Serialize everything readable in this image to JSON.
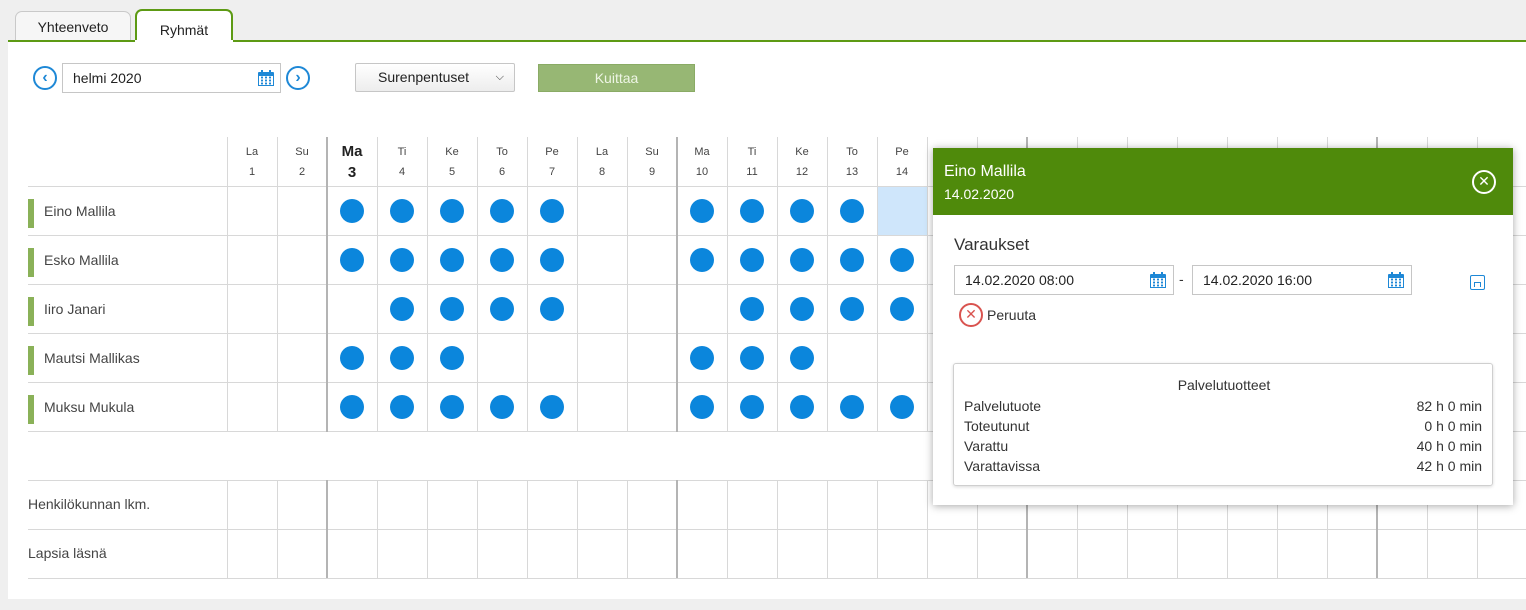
{
  "tabs": [
    {
      "label": "Yhteenveto",
      "active": false
    },
    {
      "label": "Ryhmät",
      "active": true
    }
  ],
  "toolbar": {
    "month": "helmi 2020",
    "group": "Surenpentuset",
    "acknowledge_label": "Kuittaa"
  },
  "calendar": {
    "days": [
      {
        "name": "La",
        "num": "1"
      },
      {
        "name": "Su",
        "num": "2"
      },
      {
        "name": "Ma",
        "num": "3",
        "today": true
      },
      {
        "name": "Ti",
        "num": "4"
      },
      {
        "name": "Ke",
        "num": "5"
      },
      {
        "name": "To",
        "num": "6"
      },
      {
        "name": "Pe",
        "num": "7"
      },
      {
        "name": "La",
        "num": "8"
      },
      {
        "name": "Su",
        "num": "9"
      },
      {
        "name": "Ma",
        "num": "10"
      },
      {
        "name": "Ti",
        "num": "11"
      },
      {
        "name": "Ke",
        "num": "12"
      },
      {
        "name": "To",
        "num": "13"
      },
      {
        "name": "Pe",
        "num": "14"
      }
    ],
    "children": [
      {
        "name": "Eino Mallila",
        "booked_days": [
          3,
          4,
          5,
          6,
          7,
          10,
          11,
          12,
          13
        ]
      },
      {
        "name": "Esko Mallila",
        "booked_days": [
          3,
          4,
          5,
          6,
          7,
          10,
          11,
          12,
          13,
          14
        ]
      },
      {
        "name": "Iiro Janari",
        "booked_days": [
          4,
          5,
          6,
          7,
          11,
          12,
          13,
          14
        ]
      },
      {
        "name": "Mautsi Mallikas",
        "booked_days": [
          3,
          4,
          5,
          10,
          11,
          12
        ]
      },
      {
        "name": "Muksu Mukula",
        "booked_days": [
          3,
          4,
          5,
          6,
          7,
          10,
          11,
          12,
          13,
          14
        ]
      }
    ],
    "selected": {
      "child": 0,
      "day": 14
    },
    "stats_rows": [
      "Henkilökunnan lkm.",
      "Lapsia läsnä"
    ]
  },
  "popup": {
    "name": "Eino Mallila",
    "date": "14.02.2020",
    "section_title": "Varaukset",
    "start": "14.02.2020 08:00",
    "end": "14.02.2020 16:00",
    "separator": "-",
    "cancel_label": "Peruuta",
    "products": {
      "title": "Palvelutuotteet",
      "rows": [
        {
          "label": "Palvelutuote",
          "value": "82 h 0 min"
        },
        {
          "label": "Toteutunut",
          "value": "0 h 0 min"
        },
        {
          "label": "Varattu",
          "value": "40 h 0 min"
        },
        {
          "label": "Varattavissa",
          "value": "42 h 0 min"
        }
      ]
    }
  },
  "colors": {
    "accent_green": "#4f8a0b",
    "tab_green": "#5d9a14",
    "dot_blue": "#0b86dc",
    "selected_cell": "#cfe6fb",
    "child_bar": "#8ab158"
  }
}
